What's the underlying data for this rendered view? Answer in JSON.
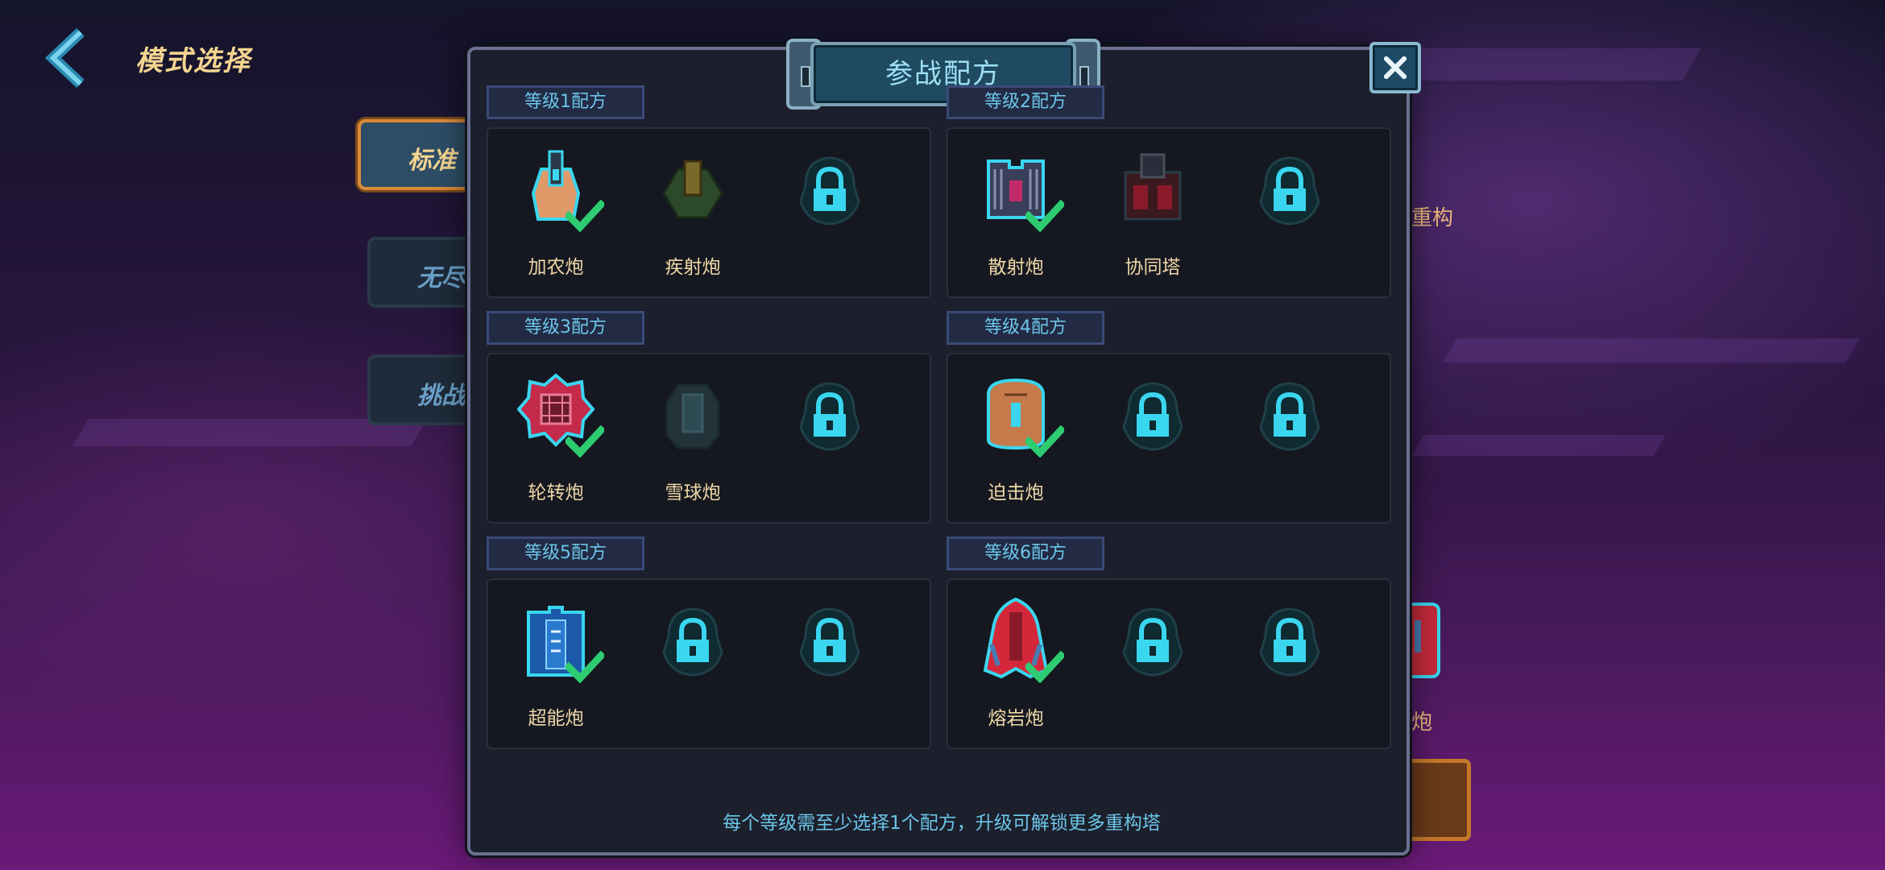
{
  "header": {
    "title": "模式选择"
  },
  "mode_tabs": [
    {
      "label": "标准",
      "active": true
    },
    {
      "label": "无尽",
      "active": false
    },
    {
      "label": "挑战",
      "active": false
    }
  ],
  "right_panel": {
    "text_top": "重构",
    "text_bottom": "炮"
  },
  "modal": {
    "title": "参战配方",
    "close_label": "✕",
    "footer": "每个等级需至少选择1个配方，升级可解锁更多重构塔",
    "tiers": [
      {
        "label": "等级1配方",
        "slots": [
          {
            "name": "加农炮",
            "icon": "cannon-icon",
            "selected": true
          },
          {
            "name": "疾射炮",
            "icon": "rapid-cannon-icon",
            "selected": false
          },
          {
            "name": "",
            "icon": "lock-icon",
            "locked": true
          }
        ]
      },
      {
        "label": "等级2配方",
        "slots": [
          {
            "name": "散射炮",
            "icon": "scatter-cannon-icon",
            "selected": true
          },
          {
            "name": "协同塔",
            "icon": "synergy-tower-icon",
            "selected": false
          },
          {
            "name": "",
            "icon": "lock-icon",
            "locked": true
          }
        ]
      },
      {
        "label": "等级3配方",
        "slots": [
          {
            "name": "轮转炮",
            "icon": "rotary-cannon-icon",
            "selected": true
          },
          {
            "name": "雪球炮",
            "icon": "snowball-cannon-icon",
            "selected": false
          },
          {
            "name": "",
            "icon": "lock-icon",
            "locked": true
          }
        ]
      },
      {
        "label": "等级4配方",
        "slots": [
          {
            "name": "迫击炮",
            "icon": "mortar-icon",
            "selected": true
          },
          {
            "name": "",
            "icon": "lock-icon",
            "locked": true
          },
          {
            "name": "",
            "icon": "lock-icon",
            "locked": true
          }
        ]
      },
      {
        "label": "等级5配方",
        "slots": [
          {
            "name": "超能炮",
            "icon": "super-cannon-icon",
            "selected": true
          },
          {
            "name": "",
            "icon": "lock-icon",
            "locked": true
          },
          {
            "name": "",
            "icon": "lock-icon",
            "locked": true
          }
        ]
      },
      {
        "label": "等级6配方",
        "slots": [
          {
            "name": "熔岩炮",
            "icon": "lava-cannon-icon",
            "selected": true
          },
          {
            "name": "",
            "icon": "lock-icon",
            "locked": true
          },
          {
            "name": "",
            "icon": "lock-icon",
            "locked": true
          }
        ]
      }
    ]
  },
  "colors": {
    "accent_cyan": "#6cc6e8",
    "label_gold": "#f0d8a8",
    "check_green": "#2ecc71",
    "lock_cyan": "#3ad6f0"
  }
}
